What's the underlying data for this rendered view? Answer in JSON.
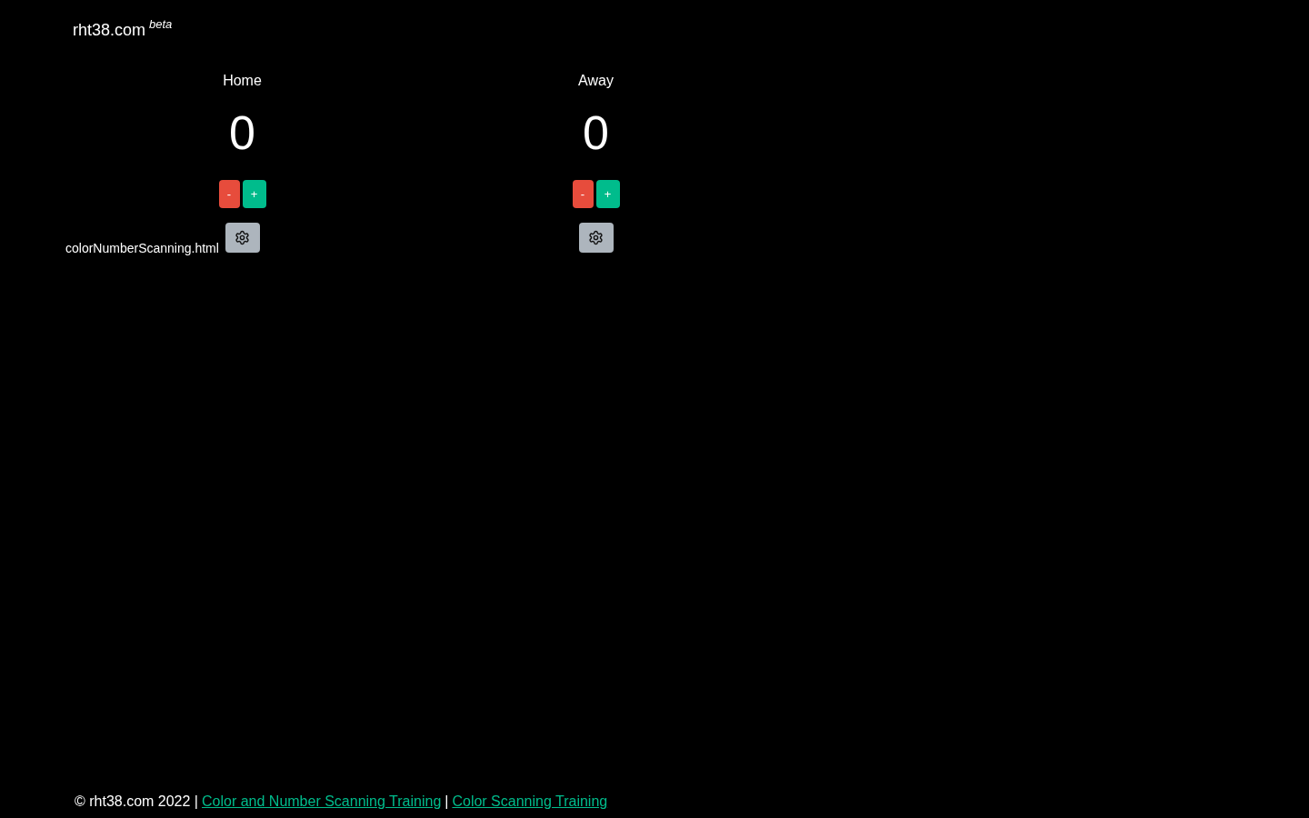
{
  "brand": {
    "name": "rht38.com",
    "tag": "beta"
  },
  "scoreboards": [
    {
      "team": "Home",
      "score": "0",
      "controls": [
        {
          "kind": "decrement",
          "label": "-"
        },
        {
          "kind": "increment",
          "label": "+"
        },
        {
          "kind": "settings"
        }
      ]
    },
    {
      "team": "Away",
      "score": "0",
      "controls": [
        {
          "kind": "decrement",
          "label": "-"
        },
        {
          "kind": "increment",
          "label": "+"
        },
        {
          "kind": "settings"
        }
      ]
    }
  ],
  "image_alt_text": "colorNumberScanning.html",
  "footer": [
    {
      "kind": "text",
      "text": "© rht38.com 2022 |"
    },
    {
      "kind": "link",
      "text": "Color and Number Scanning Training"
    },
    {
      "kind": "text",
      "text": "|"
    },
    {
      "kind": "link",
      "text": "Color Scanning Training"
    }
  ]
}
